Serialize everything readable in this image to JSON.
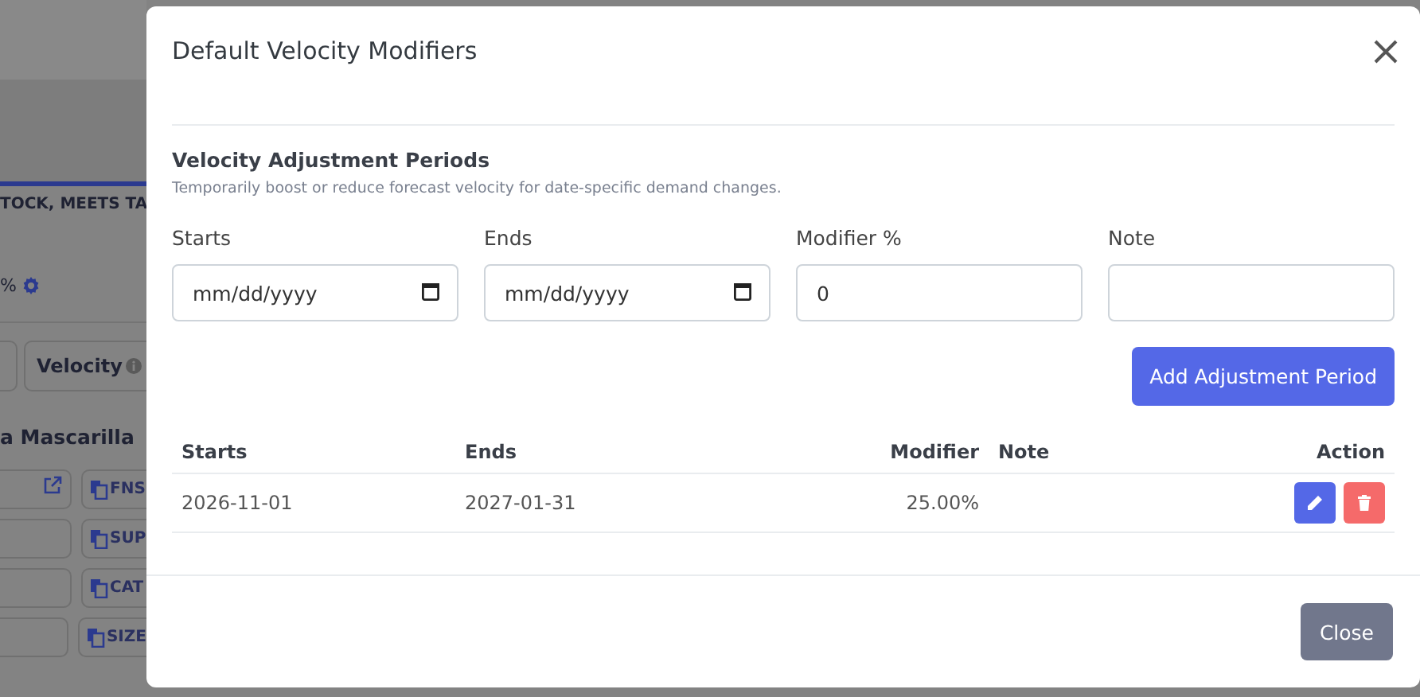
{
  "backdrop": {
    "tab_label": "TOCK, MEETS TA",
    "percent_text": "%",
    "column_header": "Velocity",
    "product_title": "a Mascarilla",
    "chips": [
      "FNS",
      "SUP",
      "CAT",
      "SIZE"
    ]
  },
  "modal": {
    "title": "Default Velocity Modifiers",
    "section_title": "Velocity Adjustment Periods",
    "description": "Temporarily boost or reduce forecast velocity for date-specific demand changes.",
    "fields": [
      {
        "kind": "date",
        "label": "Starts",
        "placeholder": "mm/dd/yyyy"
      },
      {
        "kind": "date",
        "label": "Ends",
        "placeholder": "mm/dd/yyyy"
      },
      {
        "kind": "number",
        "label": "Modifier %",
        "value": "0"
      },
      {
        "kind": "text",
        "label": "Note"
      }
    ],
    "add_button": "Add Adjustment Period",
    "table": {
      "columns": [
        "Starts",
        "Ends",
        "Modifier",
        "Note",
        "Action"
      ],
      "rows": [
        {
          "starts": "2026-11-01",
          "ends": "2027-01-31",
          "modifier": "25.00%"
        }
      ]
    },
    "close_button": "Close"
  }
}
